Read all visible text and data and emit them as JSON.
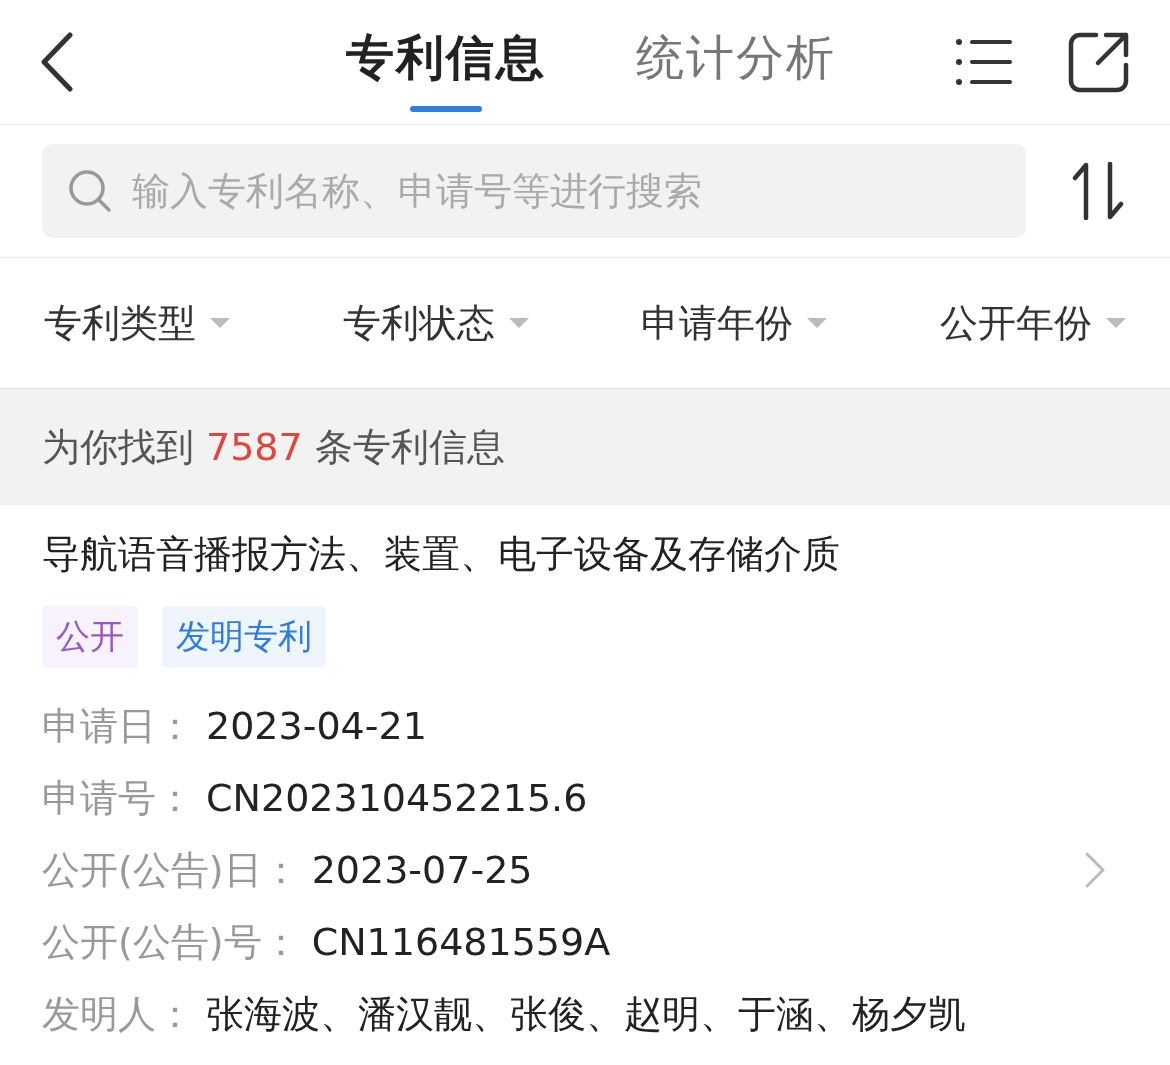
{
  "tabs": [
    {
      "label": "专利信息",
      "selected": true
    },
    {
      "label": "统计分析",
      "selected": false
    }
  ],
  "search": {
    "placeholder": "输入专利名称、申请号等进行搜索"
  },
  "filters": [
    {
      "label": "专利类型"
    },
    {
      "label": "专利状态"
    },
    {
      "label": "申请年份"
    },
    {
      "label": "公开年份"
    }
  ],
  "result": {
    "prefix": "为你找到",
    "count": "7587",
    "suffix": "条专利信息"
  },
  "patent": {
    "title": "导航语音播报方法、装置、电子设备及存储介质",
    "tags": [
      {
        "label": "公开",
        "color": "#9b59c6"
      },
      {
        "label": "发明专利",
        "color": "#2f7de1"
      }
    ],
    "fields": [
      {
        "label": "申请日：",
        "value": "2023-04-21"
      },
      {
        "label": "申请号：",
        "value": "CN202310452215.6"
      },
      {
        "label": "公开(公告)日：",
        "value": "2023-07-25"
      },
      {
        "label": "公开(公告)号：",
        "value": "CN116481559A"
      },
      {
        "label": "发明人：",
        "value": "张海波、潘汉靓、张俊、赵明、于涵、杨夕凯"
      }
    ]
  }
}
